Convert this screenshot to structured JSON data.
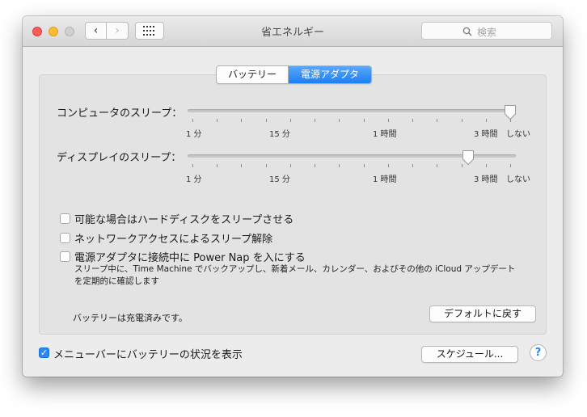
{
  "window": {
    "title": "省エネルギー",
    "search_placeholder": "検索"
  },
  "toolbar": {
    "back_icon": "‹",
    "forward_icon": "›",
    "grid_icon": "grid-icon"
  },
  "tabs": [
    {
      "label": "バッテリー",
      "selected": false
    },
    {
      "label": "電源アダプタ",
      "selected": true
    }
  ],
  "sliders": {
    "computer_sleep": {
      "label": "コンピュータのスリープ：",
      "value": "しない",
      "tick_labels": [
        "1 分",
        "15 分",
        "1 時間",
        "3 時間",
        "しない"
      ]
    },
    "display_sleep": {
      "label": "ディスプレイのスリープ：",
      "value": "3 時間",
      "tick_labels": [
        "1 分",
        "15 分",
        "1 時間",
        "3 時間",
        "しない"
      ]
    }
  },
  "options": {
    "harddisk_sleep": {
      "label": "可能な場合はハードディスクをスリープさせる",
      "checked": false
    },
    "network_wake": {
      "label": "ネットワークアクセスによるスリープ解除",
      "checked": false
    },
    "power_nap": {
      "label": "電源アダプタに接続中に Power Nap を入にする",
      "checked": false,
      "description_line1": "スリープ中に、Time Machine でバックアップし、新着メール、カレンダー、およびその他の iCloud アップデート",
      "description_line2": "を定期的に確認します"
    }
  },
  "status": {
    "battery_text": "バッテリーは充電済みです。"
  },
  "buttons": {
    "restore_defaults": "デフォルトに戻す",
    "schedule": "スケジュール...",
    "help": "?"
  },
  "menubar_battery": {
    "label": "メニューバーにバッテリーの状況を表示",
    "checked": true
  },
  "colors": {
    "accent": "#2b86f6",
    "close": "#fc5b57",
    "minimize": "#fdbb2f",
    "zoom": "#cfcfcf"
  }
}
